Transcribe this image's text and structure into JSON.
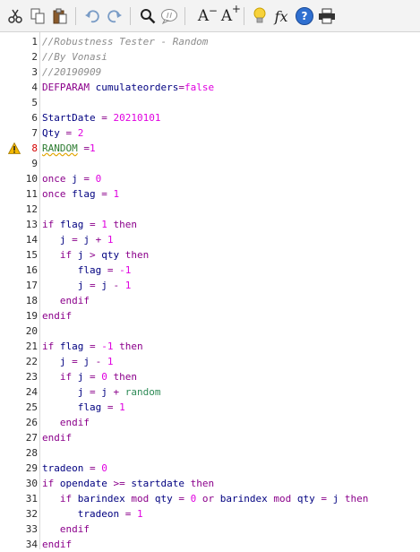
{
  "toolbar": {
    "buttons": [
      {
        "name": "cut-button",
        "icon": "scissors-icon"
      },
      {
        "name": "copy-button",
        "icon": "copy-icon"
      },
      {
        "name": "paste-button",
        "icon": "paste-icon"
      },
      {
        "name": "undo-button",
        "icon": "undo-icon"
      },
      {
        "name": "redo-button",
        "icon": "redo-icon"
      },
      {
        "name": "find-button",
        "icon": "magnifier-icon"
      },
      {
        "name": "comment-button",
        "icon": "comment-icon"
      },
      {
        "name": "decrease-font-button",
        "icon": "font-decrease-icon"
      },
      {
        "name": "increase-font-button",
        "icon": "font-increase-icon"
      },
      {
        "name": "hint-button",
        "icon": "lightbulb-icon"
      },
      {
        "name": "function-button",
        "icon": "fx-icon"
      },
      {
        "name": "help-button",
        "icon": "help-icon"
      },
      {
        "name": "print-button",
        "icon": "printer-icon"
      }
    ],
    "font_label": "A",
    "fx_label": "fx",
    "help_label": "?"
  },
  "editor": {
    "warning_line": 8,
    "lines": [
      {
        "n": "1",
        "text": "//Robustness Tester - Random"
      },
      {
        "n": "2",
        "text": "//By Vonasi"
      },
      {
        "n": "3",
        "text": "//20190909"
      },
      {
        "n": "4",
        "text": "DEFPARAM cumulateorders=false"
      },
      {
        "n": "5",
        "text": ""
      },
      {
        "n": "6",
        "text": "StartDate = 20210101"
      },
      {
        "n": "7",
        "text": "Qty = 2"
      },
      {
        "n": "8",
        "text": "RANDOM =1"
      },
      {
        "n": "9",
        "text": ""
      },
      {
        "n": "10",
        "text": "once j = 0"
      },
      {
        "n": "11",
        "text": "once flag = 1"
      },
      {
        "n": "12",
        "text": ""
      },
      {
        "n": "13",
        "text": "if flag = 1 then"
      },
      {
        "n": "14",
        "text": "   j = j + 1"
      },
      {
        "n": "15",
        "text": "   if j > qty then"
      },
      {
        "n": "16",
        "text": "      flag = -1"
      },
      {
        "n": "17",
        "text": "      j = j - 1"
      },
      {
        "n": "18",
        "text": "   endif"
      },
      {
        "n": "19",
        "text": "endif"
      },
      {
        "n": "20",
        "text": ""
      },
      {
        "n": "21",
        "text": "if flag = -1 then"
      },
      {
        "n": "22",
        "text": "   j = j - 1"
      },
      {
        "n": "23",
        "text": "   if j = 0 then"
      },
      {
        "n": "24",
        "text": "      j = j + random"
      },
      {
        "n": "25",
        "text": "      flag = 1"
      },
      {
        "n": "26",
        "text": "   endif"
      },
      {
        "n": "27",
        "text": "endif"
      },
      {
        "n": "28",
        "text": ""
      },
      {
        "n": "29",
        "text": "tradeon = 0"
      },
      {
        "n": "30",
        "text": "if opendate >= startdate then"
      },
      {
        "n": "31",
        "text": "   if barindex mod qty = 0 or barindex mod qty = j then"
      },
      {
        "n": "32",
        "text": "      tradeon = 1"
      },
      {
        "n": "33",
        "text": "   endif"
      },
      {
        "n": "34",
        "text": "endif"
      }
    ]
  },
  "colors": {
    "comment": "#8c8c8c",
    "keyword": "#8b008b",
    "number": "#e000e0",
    "identifier": "#000080",
    "function": "#2e8b57",
    "warning": "#f5b800"
  }
}
